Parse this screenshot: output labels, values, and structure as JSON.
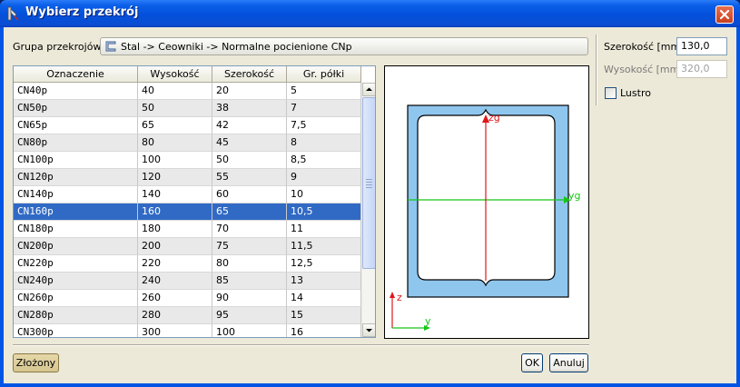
{
  "window": {
    "title": "Wybierz przekrój"
  },
  "group": {
    "label": "Grupa przekrojów",
    "value": "Stal -> Ceowniki -> Normalne pocienione CNp"
  },
  "table": {
    "headers": [
      "Oznaczenie",
      "Wysokość",
      "Szerokość",
      "Gr. półki"
    ],
    "rows": [
      [
        "CN40p",
        "40",
        "20",
        "5"
      ],
      [
        "CN50p",
        "50",
        "38",
        "7"
      ],
      [
        "CN65p",
        "65",
        "42",
        "7,5"
      ],
      [
        "CN80p",
        "80",
        "45",
        "8"
      ],
      [
        "CN100p",
        "100",
        "50",
        "8,5"
      ],
      [
        "CN120p",
        "120",
        "55",
        "9"
      ],
      [
        "CN140p",
        "140",
        "60",
        "10"
      ],
      [
        "CN160p",
        "160",
        "65",
        "10,5"
      ],
      [
        "CN180p",
        "180",
        "70",
        "11"
      ],
      [
        "CN200p",
        "200",
        "75",
        "11,5"
      ],
      [
        "CN220p",
        "220",
        "80",
        "12,5"
      ],
      [
        "CN240p",
        "240",
        "85",
        "13"
      ],
      [
        "CN260p",
        "260",
        "90",
        "14"
      ],
      [
        "CN280p",
        "280",
        "95",
        "15"
      ],
      [
        "CN300p",
        "300",
        "100",
        "16"
      ]
    ],
    "selected_index": 7
  },
  "preview": {
    "axis_zg": "zg",
    "axis_yg": "yg",
    "axis_z": "z",
    "axis_y": "y"
  },
  "params": {
    "width_label": "Szerokość [mm]",
    "width_value": "130,0",
    "height_label": "Wysokość [mm]",
    "height_value": "320,0",
    "mirror_label": "Lustro",
    "mirror_checked": false
  },
  "buttons": {
    "compound": "Złożony",
    "ok": "OK",
    "cancel": "Anuluj"
  },
  "colors": {
    "titlebar": "#0450db",
    "selection": "#316ac5",
    "section_fill": "#8fc6ee",
    "axis_red": "#e0161a",
    "axis_green": "#17c517",
    "face": "#ece9d8"
  }
}
